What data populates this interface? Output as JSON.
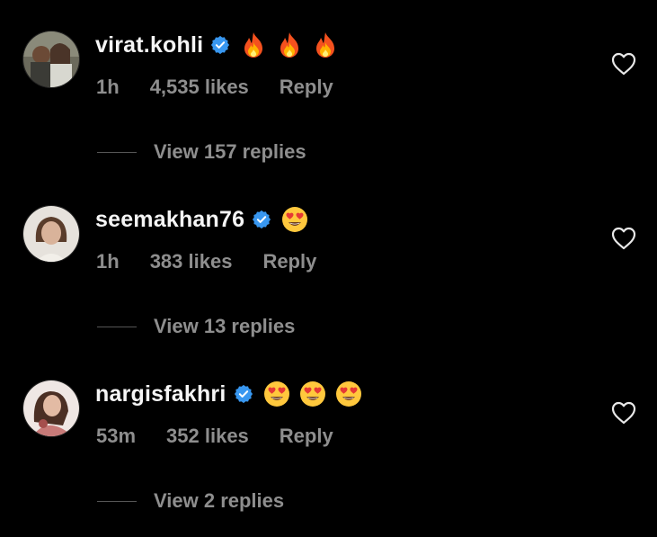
{
  "comments": [
    {
      "username": "virat.kohli",
      "verified": true,
      "emojis": [
        "fire-emoji",
        "fire-emoji",
        "fire-emoji"
      ],
      "time": "1h",
      "likes": "4,535 likes",
      "reply_label": "Reply",
      "view_replies": "View 157 replies",
      "avatar": "avatar-icon"
    },
    {
      "username": "seemakhan76",
      "verified": true,
      "emojis": [
        "heart-eyes-emoji"
      ],
      "time": "1h",
      "likes": "383 likes",
      "reply_label": "Reply",
      "view_replies": "View 13 replies",
      "avatar": "avatar-icon"
    },
    {
      "username": "nargisfakhri",
      "verified": true,
      "emojis": [
        "heart-eyes-emoji",
        "heart-eyes-emoji",
        "heart-eyes-emoji"
      ],
      "time": "53m",
      "likes": "352 likes",
      "reply_label": "Reply",
      "view_replies": "View 2 replies",
      "avatar": "avatar-icon"
    }
  ],
  "colors": {
    "background": "#000000",
    "text_primary": "#f5f5f5",
    "text_secondary": "#8e8e8e",
    "verified_blue": "#3897f0"
  }
}
